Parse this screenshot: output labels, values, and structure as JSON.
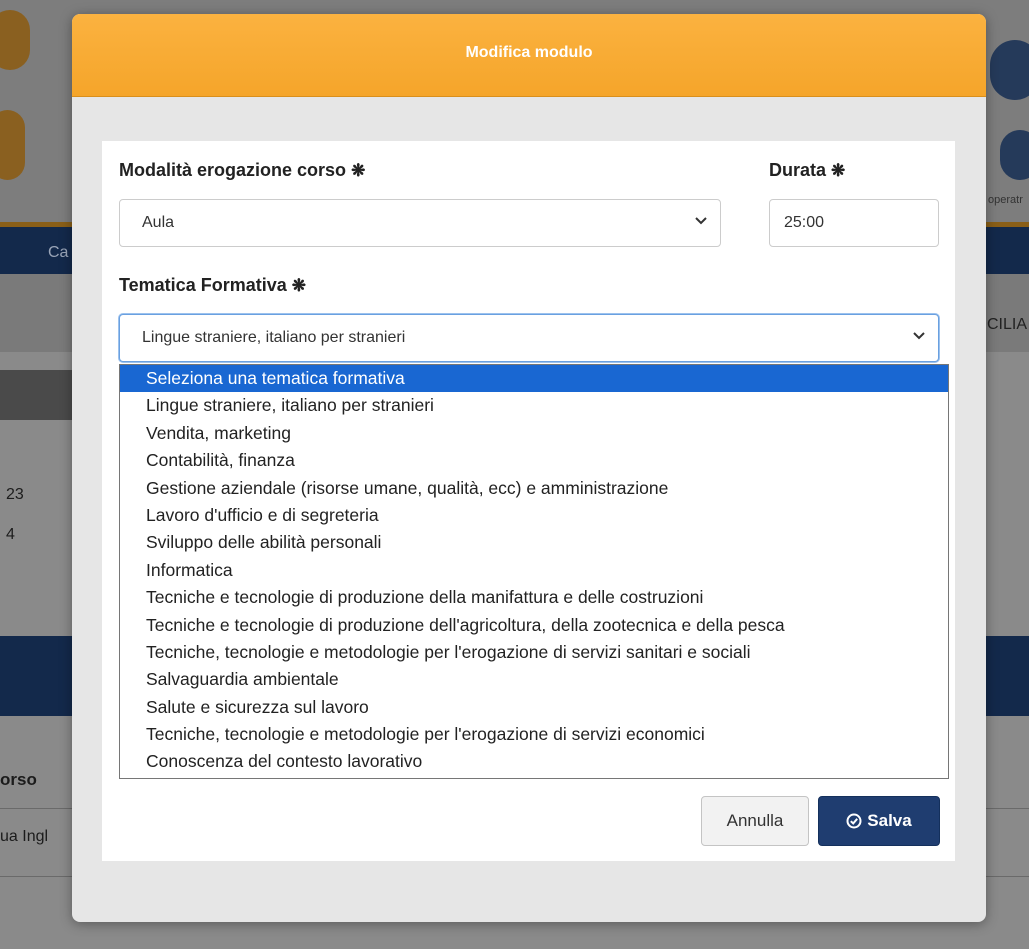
{
  "background": {
    "nav_item": "Ca",
    "sub_text": "CILIA",
    "frag_1": "23",
    "frag_2": "4",
    "column_header": "orso",
    "row_text": "ua Ingl",
    "logo_text": "operatr"
  },
  "modal": {
    "title": "Modifica modulo",
    "modalita": {
      "label": "Modalità erogazione corso",
      "required_mark": "❋",
      "value": "Aula"
    },
    "durata": {
      "label": "Durata",
      "required_mark": "❋",
      "value": "25:00"
    },
    "tematica": {
      "label": "Tematica Formativa",
      "required_mark": "❋",
      "value": "Lingue straniere, italiano per stranieri",
      "options": [
        "Seleziona una tematica formativa",
        "Lingue straniere, italiano per stranieri",
        "Vendita, marketing",
        "Contabilità, finanza",
        "Gestione aziendale (risorse umane, qualità, ecc) e amministrazione",
        "Lavoro d'ufficio e di segreteria",
        "Sviluppo delle abilità personali",
        "Informatica",
        "Tecniche e tecnologie di produzione della manifattura e delle costruzioni",
        "Tecniche e tecnologie di produzione dell'agricoltura, della zootecnica e della pesca",
        "Tecniche, tecnologie e metodologie per l'erogazione di servizi sanitari e sociali",
        "Salvaguardia ambientale",
        "Salute e sicurezza sul lavoro",
        "Tecniche, tecnologie e metodologie per l'erogazione di servizi economici",
        "Conoscenza del contesto lavorativo"
      ],
      "highlighted_index": 0
    },
    "buttons": {
      "cancel": "Annulla",
      "save": "Salva"
    }
  },
  "colors": {
    "header_orange": "#f5a52a",
    "save_blue": "#1f3d70",
    "highlight_blue": "#1967d2"
  }
}
